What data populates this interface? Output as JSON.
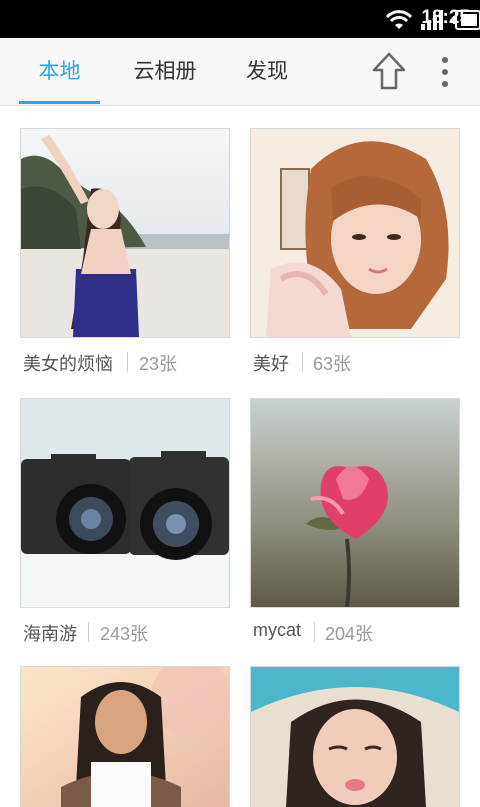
{
  "status_bar": {
    "time": "18:25",
    "icons": [
      "wifi-icon",
      "signal-icon",
      "battery-icon"
    ]
  },
  "app_bar": {
    "tabs": [
      {
        "label": "本地",
        "active": true
      },
      {
        "label": "云相册",
        "active": false
      },
      {
        "label": "发现",
        "active": false
      }
    ],
    "actions": [
      "upload-icon",
      "more-vert-icon"
    ],
    "accent_color": "#2ea6e6"
  },
  "albums": [
    {
      "name": "美女的烦恼",
      "count": "23张"
    },
    {
      "name": "美好",
      "count": "63张"
    },
    {
      "name": "海南游",
      "count": "243张"
    },
    {
      "name": "mycat",
      "count": "204张"
    },
    {
      "name": "",
      "count": ""
    },
    {
      "name": "",
      "count": ""
    }
  ]
}
